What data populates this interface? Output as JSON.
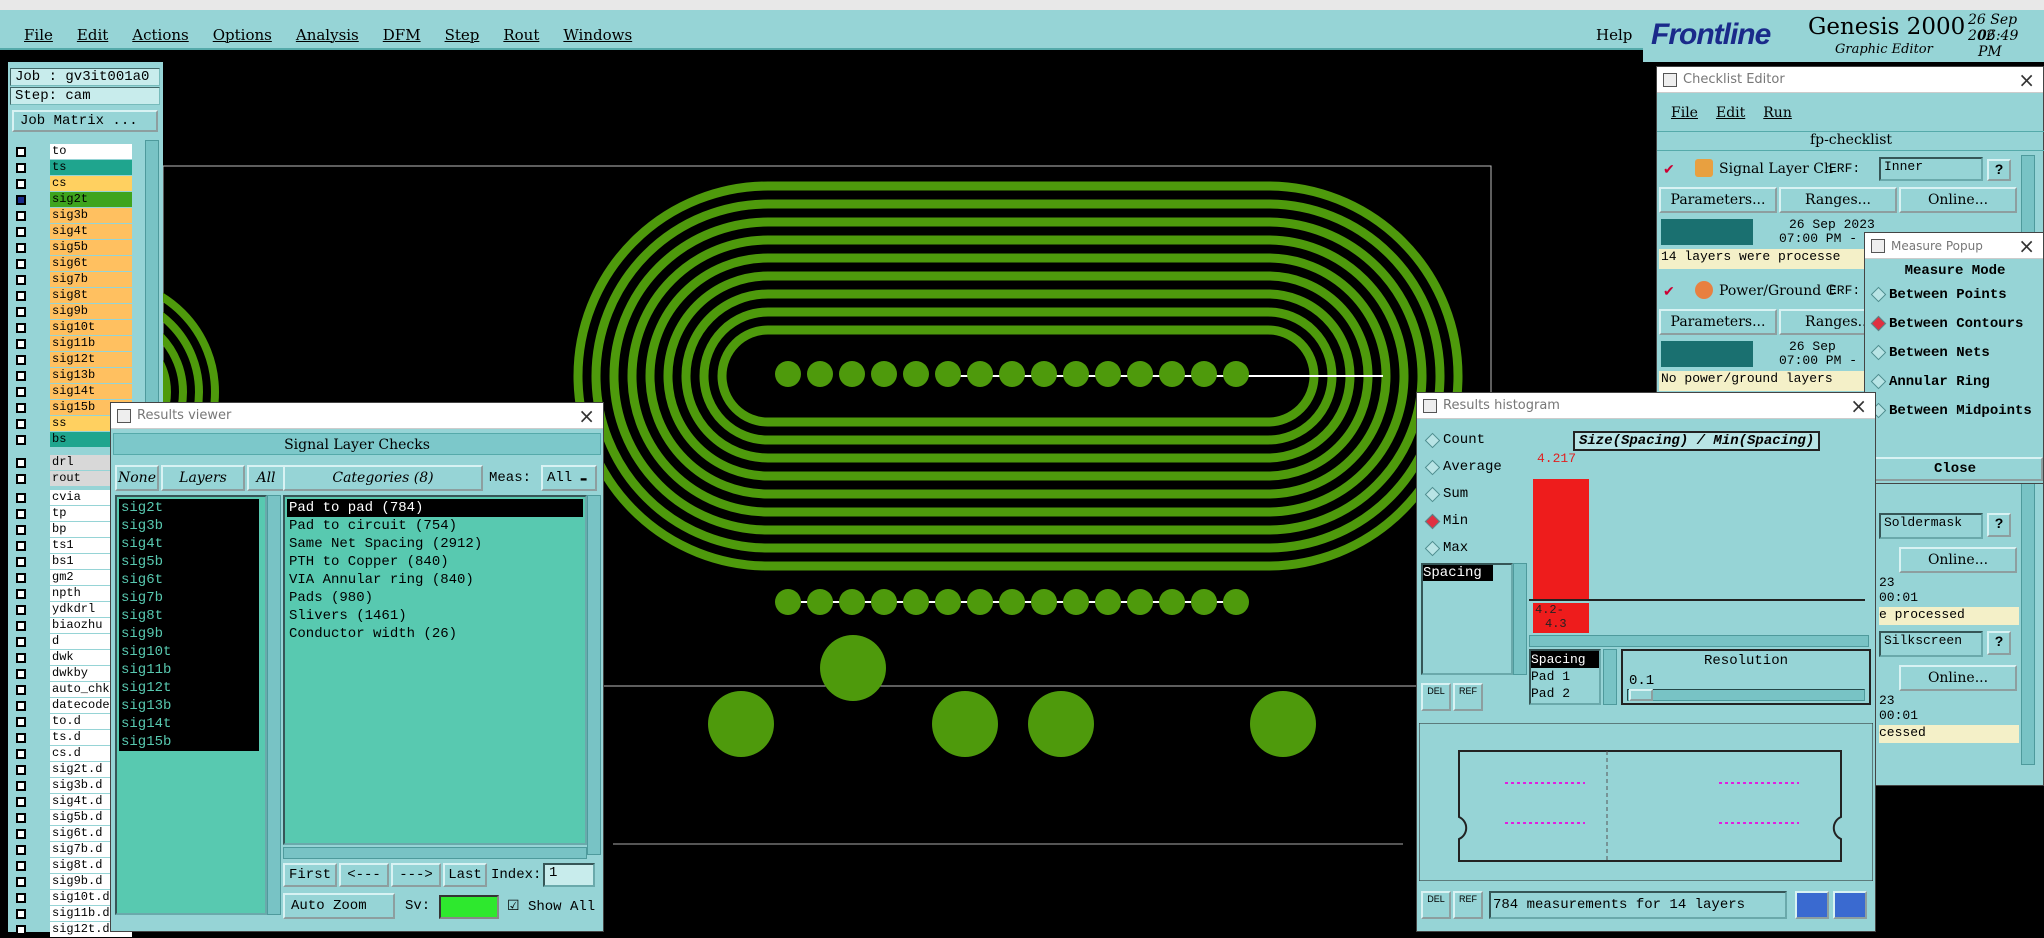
{
  "menu": [
    "File",
    "Edit",
    "Actions",
    "Options",
    "Analysis",
    "DFM",
    "Step",
    "Rout",
    "Windows"
  ],
  "help": "Help",
  "brand": {
    "logo": "Frontline",
    "product": "Genesis 2000",
    "sub": "Graphic Editor",
    "date": "26 Sep 202",
    "time": "06:49 PM"
  },
  "job": {
    "job": "Job : gv3it001a0",
    "step": "Step: cam",
    "matrix": "Job Matrix ..."
  },
  "layers_top": [
    {
      "name": "to",
      "color": "#ffffff"
    },
    {
      "name": "ts",
      "color": "#1fa58e"
    },
    {
      "name": "cs",
      "color": "#ffd060"
    },
    {
      "name": "sig2t",
      "color": "#3ea41e"
    },
    {
      "name": "sig3b",
      "color": "#ffc060"
    },
    {
      "name": "sig4t",
      "color": "#ffc060"
    },
    {
      "name": "sig5b",
      "color": "#ffc060"
    },
    {
      "name": "sig6t",
      "color": "#ffc060"
    },
    {
      "name": "sig7b",
      "color": "#ffc060"
    },
    {
      "name": "sig8t",
      "color": "#ffc060"
    },
    {
      "name": "sig9b",
      "color": "#ffc060"
    },
    {
      "name": "sig10t",
      "color": "#ffc060"
    },
    {
      "name": "sig11b",
      "color": "#ffc060"
    },
    {
      "name": "sig12t",
      "color": "#ffc060"
    },
    {
      "name": "sig13b",
      "color": "#ffc060"
    },
    {
      "name": "sig14t",
      "color": "#ffc060"
    },
    {
      "name": "sig15b",
      "color": "#ffc060"
    },
    {
      "name": "ss",
      "color": "#ffd060"
    },
    {
      "name": "bs",
      "color": "#1fa58e"
    }
  ],
  "layers_mid": [
    "drl",
    "rout"
  ],
  "layers_bottom": [
    "cvia",
    "tp",
    "bp",
    "ts1",
    "bs1",
    "gm2",
    "npth",
    "ydkdrl",
    "biaozhu",
    "d",
    "dwk",
    "dwkby",
    "auto_chk",
    "datecode",
    "to.d",
    "ts.d",
    "cs.d",
    "sig2t.d",
    "sig3b.d",
    "sig4t.d",
    "sig5b.d",
    "sig6t.d",
    "sig7b.d",
    "sig8t.d",
    "sig9b.d",
    "sig10t.d",
    "sig11b.d",
    "sig12t.d"
  ],
  "results_viewer": {
    "title": "Results viewer",
    "header": "Signal Layer Checks",
    "none": "None",
    "layers": "Layers",
    "all": "All",
    "categories": "Categories (8)",
    "meas": "Meas:",
    "meas_val": "All",
    "layer_list": [
      "sig2t",
      "sig3b",
      "sig4t",
      "sig5b",
      "sig6t",
      "sig7b",
      "sig8t",
      "sig9b",
      "sig10t",
      "sig11b",
      "sig12t",
      "sig13b",
      "sig14t",
      "sig15b"
    ],
    "cat_list": [
      "Pad to pad (784)",
      "Pad to circuit (754)",
      "Same Net Spacing (2912)",
      "PTH to Copper (840)",
      "VIA Annular ring (840)",
      "Pads (980)",
      "Slivers (1461)",
      "Conductor width (26)"
    ],
    "first": "First",
    "prev": "<---",
    "next": "--->",
    "last": "Last",
    "index": "Index:",
    "index_val": "1",
    "autozoom": "Auto Zoom",
    "sv": "Sv:",
    "show_all": "Show All"
  },
  "checklist": {
    "title": "Checklist Editor",
    "menu": [
      "File",
      "Edit",
      "Run"
    ],
    "name": "fp-checklist",
    "item1": {
      "name": "Signal Layer Ch",
      "erf": "ERF:",
      "erf_val": "Inner",
      "date": "26 Sep 2023",
      "time": "07:00 PM -",
      "msg": "14 layers were processe"
    },
    "item2": {
      "name": "Power/Ground C",
      "erf": "ERF:",
      "date": "26 Sep",
      "time": "07:00 PM -",
      "msg": "No power/ground layers"
    },
    "params": "Parameters...",
    "ranges": "Ranges...",
    "online": "Online...",
    "item3": {
      "erf_val": "Soldermask",
      "date": "23",
      "time": "00:01",
      "msg": "e processed"
    },
    "item4": {
      "erf_val": "Silkscreen",
      "date": "23",
      "time": "00:01",
      "msg": "cessed"
    }
  },
  "measure": {
    "title": "Measure Popup",
    "mode": "Measure Mode",
    "options": [
      "Between Points",
      "Between Contours",
      "Between Nets",
      "Annular Ring",
      "Between Midpoints"
    ],
    "selected": 1,
    "close": "Close"
  },
  "histogram": {
    "title": "Results histogram",
    "options": [
      "Count",
      "Average",
      "Sum",
      "Min",
      "Max"
    ],
    "selected": 3,
    "list": [
      "Spacing"
    ],
    "chart_title": "Size(Spacing) / Min(Spacing)",
    "bar_value": "4.217",
    "bin_label": "4.2-",
    "bin_label2": "4.3",
    "sel_list": [
      "Spacing",
      "Pad 1",
      "Pad 2"
    ],
    "resolution": "Resolution",
    "res_val": "0.1",
    "status": "784 measurements for 14 layers"
  }
}
